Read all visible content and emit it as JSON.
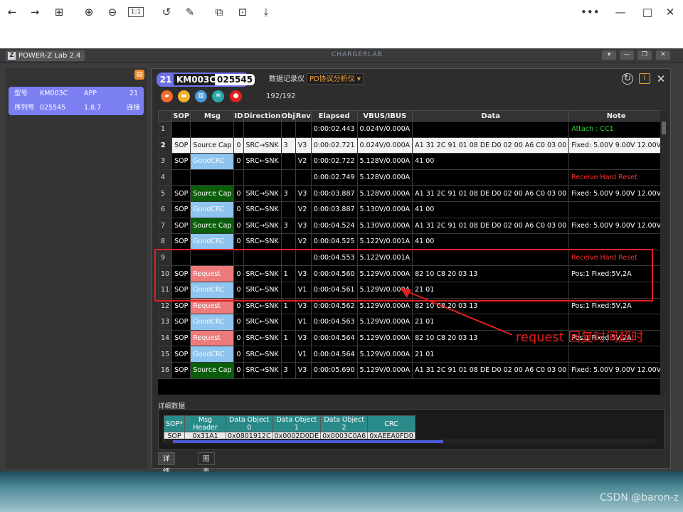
{
  "browser": {
    "buttons": [
      "←",
      "→",
      "⊞",
      "⊕",
      "⊖",
      "1:1",
      "↺",
      "✎",
      "⧉",
      "⊡",
      "⤓"
    ],
    "more": "•••",
    "min": "—",
    "max": "□",
    "close": "✕"
  },
  "app": {
    "title": "POWER-Z Lab 2.4",
    "brand": "CHARGERLAB",
    "controls": [
      "▾",
      "—",
      "❐",
      "✕"
    ]
  },
  "left": {
    "card": {
      "r1": [
        "型号",
        "KM003C",
        "APP",
        "21"
      ],
      "r2": [
        "序列号",
        "025545",
        "1.8.7",
        "连接"
      ]
    }
  },
  "device": {
    "num": "21",
    "model": "KM003C",
    "serial": "025545"
  },
  "modes": {
    "log": "数据记录仪",
    "pd": "PD协议分析仪 ▾"
  },
  "toolbar": {
    "count": "192/192"
  },
  "columns": [
    "SOP",
    "Msg",
    "ID",
    "Direction",
    "Obj",
    "Rev",
    "Elapsed",
    "VBUS/IBUS",
    "Data",
    "Note"
  ],
  "rows": [
    {
      "n": "1",
      "sop": "",
      "msg": "",
      "mt": "",
      "id": "",
      "dir": "",
      "obj": "",
      "rev": "",
      "el": "0:00:02.443",
      "v": "0.024V/0.000A",
      "data": "",
      "note": "Attach : CC1",
      "nt": "g",
      "light": false
    },
    {
      "n": "2",
      "sop": "SOP",
      "msg": "Source Cap",
      "mt": "",
      "id": "0",
      "dir": "SRC→SNK",
      "obj": "3",
      "rev": "V3",
      "el": "0:00:02.721",
      "v": "0.024V/0.000A",
      "data": "A1 31 2C 91 01 08 DE D0 02 00 A6 C0 03 00",
      "note": "Fixed: 5.00V  9.00V  12.00V",
      "nt": "",
      "light": true
    },
    {
      "n": "3",
      "sop": "SOP",
      "msg": "GoodCRC",
      "mt": "crc",
      "id": "0",
      "dir": "SRC←SNK",
      "obj": "",
      "rev": "V2",
      "el": "0:00:02.722",
      "v": "5.128V/0.000A",
      "data": "41 00",
      "note": "",
      "nt": "",
      "light": false
    },
    {
      "n": "4",
      "sop": "",
      "msg": "",
      "mt": "",
      "id": "",
      "dir": "",
      "obj": "",
      "rev": "",
      "el": "0:00:02.749",
      "v": "5.128V/0.000A",
      "data": "",
      "note": "Receive Hard Reset",
      "nt": "r",
      "light": false
    },
    {
      "n": "5",
      "sop": "SOP",
      "msg": "Source Cap",
      "mt": "src",
      "id": "0",
      "dir": "SRC→SNK",
      "obj": "3",
      "rev": "V3",
      "el": "0:00:03.887",
      "v": "5.128V/0.000A",
      "data": "A1 31 2C 91 01 08 DE D0 02 00 A6 C0 03 00",
      "note": "Fixed: 5.00V  9.00V  12.00V",
      "nt": "",
      "light": false
    },
    {
      "n": "6",
      "sop": "SOP",
      "msg": "GoodCRC",
      "mt": "crc",
      "id": "0",
      "dir": "SRC←SNK",
      "obj": "",
      "rev": "V2",
      "el": "0:00:03.887",
      "v": "5.130V/0.000A",
      "data": "41 00",
      "note": "",
      "nt": "",
      "light": false
    },
    {
      "n": "7",
      "sop": "SOP",
      "msg": "Source Cap",
      "mt": "src",
      "id": "0",
      "dir": "SRC→SNK",
      "obj": "3",
      "rev": "V3",
      "el": "0:00:04.524",
      "v": "5.130V/0.000A",
      "data": "A1 31 2C 91 01 08 DE D0 02 00 A6 C0 03 00",
      "note": "Fixed: 5.00V  9.00V  12.00V",
      "nt": "",
      "light": false
    },
    {
      "n": "8",
      "sop": "SOP",
      "msg": "GoodCRC",
      "mt": "crc",
      "id": "0",
      "dir": "SRC←SNK",
      "obj": "",
      "rev": "V2",
      "el": "0:00:04.525",
      "v": "5.122V/0.001A",
      "data": "41 00",
      "note": "",
      "nt": "",
      "light": false
    },
    {
      "n": "9",
      "sop": "",
      "msg": "",
      "mt": "",
      "id": "",
      "dir": "",
      "obj": "",
      "rev": "",
      "el": "0:00:04.553",
      "v": "5.122V/0.001A",
      "data": "",
      "note": "Receive Hard Reset",
      "nt": "r",
      "light": false
    },
    {
      "n": "10",
      "sop": "SOP",
      "msg": "Request",
      "mt": "req",
      "id": "0",
      "dir": "SRC←SNK",
      "obj": "1",
      "rev": "V3",
      "el": "0:00:04.560",
      "v": "5.129V/0.000A",
      "data": "82 10 C8 20 03 13",
      "note": "Pos:1 Fixed:5V,2A",
      "nt": "",
      "light": false
    },
    {
      "n": "11",
      "sop": "SOP",
      "msg": "GoodCRC",
      "mt": "crc",
      "id": "0",
      "dir": "SRC←SNK",
      "obj": "",
      "rev": "V1",
      "el": "0:00:04.561",
      "v": "5.129V/0.000A",
      "data": "21 01",
      "note": "",
      "nt": "",
      "light": false
    },
    {
      "n": "12",
      "sop": "SOP",
      "msg": "Request",
      "mt": "req",
      "id": "0",
      "dir": "SRC←SNK",
      "obj": "1",
      "rev": "V3",
      "el": "0:00:04.562",
      "v": "5.129V/0.000A",
      "data": "82 10 C8 20 03 13",
      "note": "Pos:1 Fixed:5V,2A",
      "nt": "",
      "light": false
    },
    {
      "n": "13",
      "sop": "SOP",
      "msg": "GoodCRC",
      "mt": "crc",
      "id": "0",
      "dir": "SRC←SNK",
      "obj": "",
      "rev": "V1",
      "el": "0:00:04.563",
      "v": "5.129V/0.000A",
      "data": "21 01",
      "note": "",
      "nt": "",
      "light": false
    },
    {
      "n": "14",
      "sop": "SOP",
      "msg": "Request",
      "mt": "req",
      "id": "0",
      "dir": "SRC←SNK",
      "obj": "1",
      "rev": "V3",
      "el": "0:00:04.564",
      "v": "5.129V/0.000A",
      "data": "82 10 C8 20 03 13",
      "note": "Pos:1 Fixed:5V,2A",
      "nt": "",
      "light": false
    },
    {
      "n": "15",
      "sop": "SOP",
      "msg": "GoodCRC",
      "mt": "crc",
      "id": "0",
      "dir": "SRC←SNK",
      "obj": "",
      "rev": "V1",
      "el": "0:00:04.564",
      "v": "5.129V/0.000A",
      "data": "21 01",
      "note": "",
      "nt": "",
      "light": false
    },
    {
      "n": "16",
      "sop": "SOP",
      "msg": "Source Cap",
      "mt": "src",
      "id": "0",
      "dir": "SRC→SNK",
      "obj": "3",
      "rev": "V3",
      "el": "0:00:05.690",
      "v": "5.129V/0.000A",
      "data": "A1 31 2C 91 01 08 DE D0 02 00 A6 C0 03 00",
      "note": "Fixed: 5.00V  9.00V  12.00V",
      "nt": "",
      "light": false
    }
  ],
  "annotation": "request 回复时间超时",
  "detail": {
    "label": "详细数据",
    "cols": [
      "SOP*",
      "Msg Header",
      "Data Object 0",
      "Data Object 1",
      "Data Object 2",
      "CRC"
    ],
    "vals": [
      "SOP",
      "0x31A1",
      "0x0801912C",
      "0x0002D0DE",
      "0x0003C0A6",
      "0xAEEA0FD0"
    ],
    "tabs": [
      "详细数据",
      "图表"
    ]
  },
  "watermark": "CSDN @baron-z",
  "colors": {
    "accent": "#6f72e8",
    "source_cap": "#0a5d0a",
    "goodcrc": "#8ec4ee",
    "request": "#ee7b7b",
    "highlight": "#e02020"
  }
}
